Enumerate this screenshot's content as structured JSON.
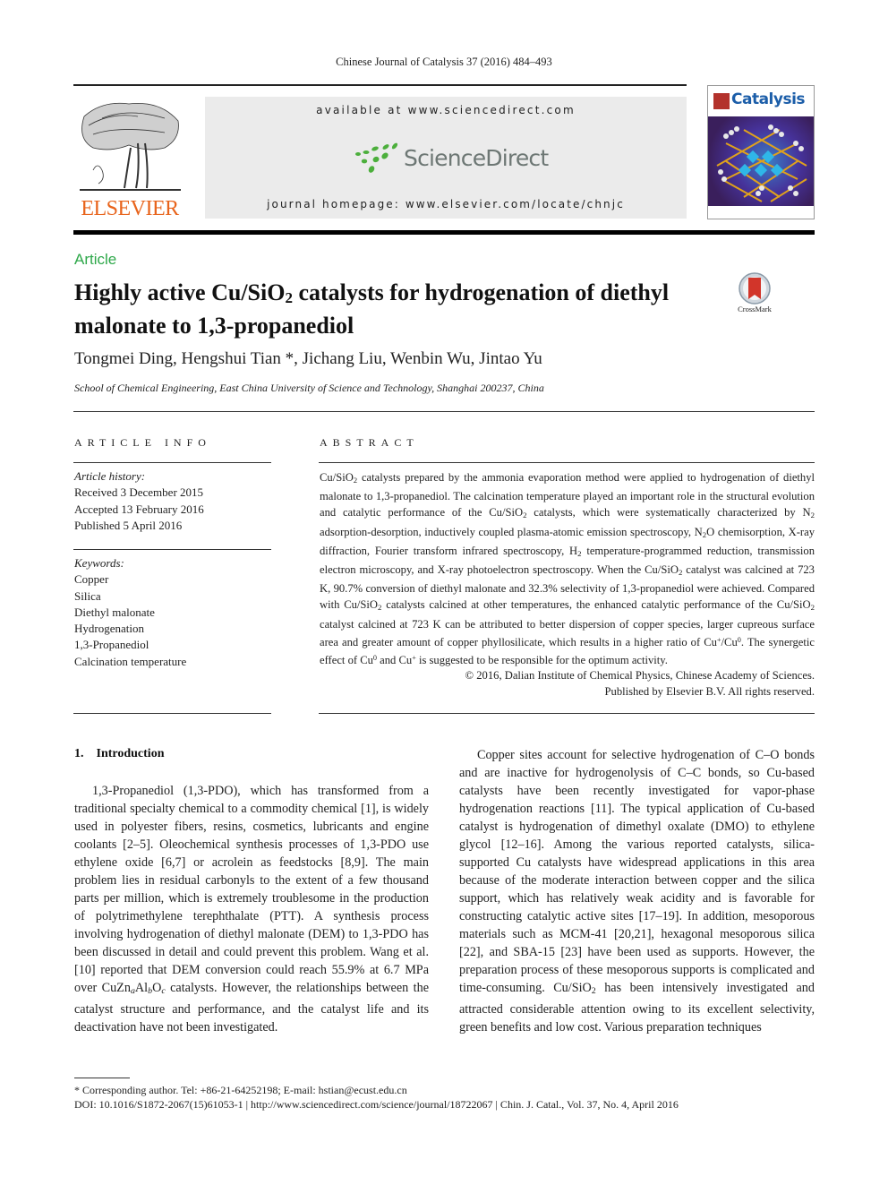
{
  "header": {
    "journal_reference": "Chinese Journal of Catalysis 37 (2016) 484–493",
    "publisher_logo": "ELSEVIER",
    "available_at": "available at www.sciencedirect.com",
    "sciencedirect_label": "ScienceDirect",
    "journal_homepage": "journal homepage: www.elsevier.com/locate/chnjc",
    "cover_title": "Catalysis",
    "colors": {
      "elsevier_orange": "#e8641c",
      "sciencedirect_green": "#4caf3c",
      "sciencedirect_gray": "#6d7774",
      "cover_blue": "#1c5ea9"
    }
  },
  "article": {
    "type_label": "Article",
    "type_label_color": "#2ea84a",
    "title_part1": "Highly active Cu/SiO",
    "title_sub": "2",
    "title_part2": " catalysts for hydrogenation of diethyl malonate to 1,3-propanediol",
    "crossmark_label": "CrossMark",
    "authors": "Tongmei Ding, Hengshui Tian *, Jichang Liu, Wenbin Wu, Jintao Yu",
    "affiliation": "School of Chemical Engineering, East China University of Science and Technology, Shanghai 200237, China"
  },
  "article_info": {
    "heading": "ARTICLE INFO",
    "history_label": "Article history:",
    "history": [
      "Received 3 December 2015",
      "Accepted 13 February 2016",
      "Published 5 April 2016"
    ],
    "keywords_label": "Keywords:",
    "keywords": [
      "Copper",
      "Silica",
      "Diethyl malonate",
      "Hydrogenation",
      "1,3-Propanediol",
      "Calcination temperature"
    ]
  },
  "abstract": {
    "heading": "ABSTRACT",
    "segments": [
      "Cu/SiO",
      "2",
      " catalysts prepared by the ammonia evaporation method were applied to hydrogenation of diethyl malonate to 1,3-propanediol. The calcination temperature played an important role in the structural evolution and catalytic performance of the Cu/SiO",
      "2",
      " catalysts, which were systematically characterized by N",
      "2",
      " adsorption-desorption, inductively coupled plasma-atomic emission spectroscopy, N",
      "2",
      "O chemisorption, X-ray diffraction, Fourier transform infrared spectroscopy, H",
      "2",
      " temperature-programmed reduction, transmission electron microscopy, and X-ray photoelectron spectroscopy. When the Cu/SiO",
      "2",
      " catalyst was calcined at 723 K, 90.7% conversion of diethyl malonate and 32.3% selectivity of 1,3-propanediol were achieved. Compared with Cu/SiO",
      "2",
      " catalysts calcined at other temperatures, the enhanced catalytic performance of the Cu/SiO",
      "2",
      " catalyst calcined at 723 K can be attributed to better dispersion of copper species, larger cupreous surface area and greater amount of copper phyllosilicate, which results in a higher ratio of Cu",
      "+",
      "/Cu",
      "0",
      ". The synergetic effect of Cu",
      "0",
      " and Cu",
      "+",
      " is suggested to be responsible for the optimum activity."
    ],
    "copyright_line1": "© 2016, Dalian Institute of Chemical Physics, Chinese Academy of Sciences.",
    "copyright_line2": "Published by Elsevier B.V. All rights reserved."
  },
  "body": {
    "section_heading": "1.    Introduction",
    "left_paragraph": [
      "1,3-Propanediol (1,3-PDO), which has transformed from a traditional specialty chemical to a commodity chemical [1], is widely used in polyester fibers, resins, cosmetics, lubricants and engine coolants [2–5]. Oleochemical synthesis processes of 1,3-PDO use ethylene oxide [6,7] or acrolein as feedstocks [8,9]. The main problem lies in residual carbonyls to the extent of a few thousand parts per million, which is extremely troublesome in the production of polytrimethylene terephthalate (PTT). A synthesis process involving hydrogenation of diethyl malonate (DEM) to 1,3-PDO has been discussed in detail and could prevent this problem. Wang et al. [10] reported that DEM conversion could reach 55.9% at 6.7 MPa over CuZn",
      "a",
      "Al",
      "b",
      "O",
      "c",
      " catalysts. However, the relationships between the catalyst structure and performance, and the catalyst life and its deactivation have not been investigated."
    ],
    "right_paragraph": [
      "Copper sites account for selective hydrogenation of C–O bonds and are inactive for hydrogenolysis of C–C bonds, so Cu-based catalysts have been recently investigated for vapor-phase hydrogenation reactions [11]. The typical application of Cu-based catalyst is hydrogenation of dimethyl oxalate (DMO) to ethylene glycol [12–16]. Among the various reported catalysts, silica-supported Cu catalysts have widespread applications in this area because of the moderate interaction between copper and the silica support, which has relatively weak acidity and is favorable for constructing catalytic active sites [17–19]. In addition, mesoporous materials such as MCM-41 [20,21], hexagonal mesoporous silica [22], and SBA-15 [23] have been used as supports. However, the preparation process of these mesoporous supports is complicated and time-consuming. Cu/SiO",
      "2",
      " has been intensively investigated and attracted considerable attention owing to its excellent selectivity, green benefits and low cost. Various preparation techniques"
    ]
  },
  "footer": {
    "corresponding_author": "* Corresponding author. Tel: +86-21-64252198; E-mail: hstian@ecust.edu.cn",
    "doi_line": "DOI: 10.1016/S1872-2067(15)61053-1 | http://www.sciencedirect.com/science/journal/18722067 | Chin. J. Catal., Vol. 37, No. 4, April 2016"
  }
}
